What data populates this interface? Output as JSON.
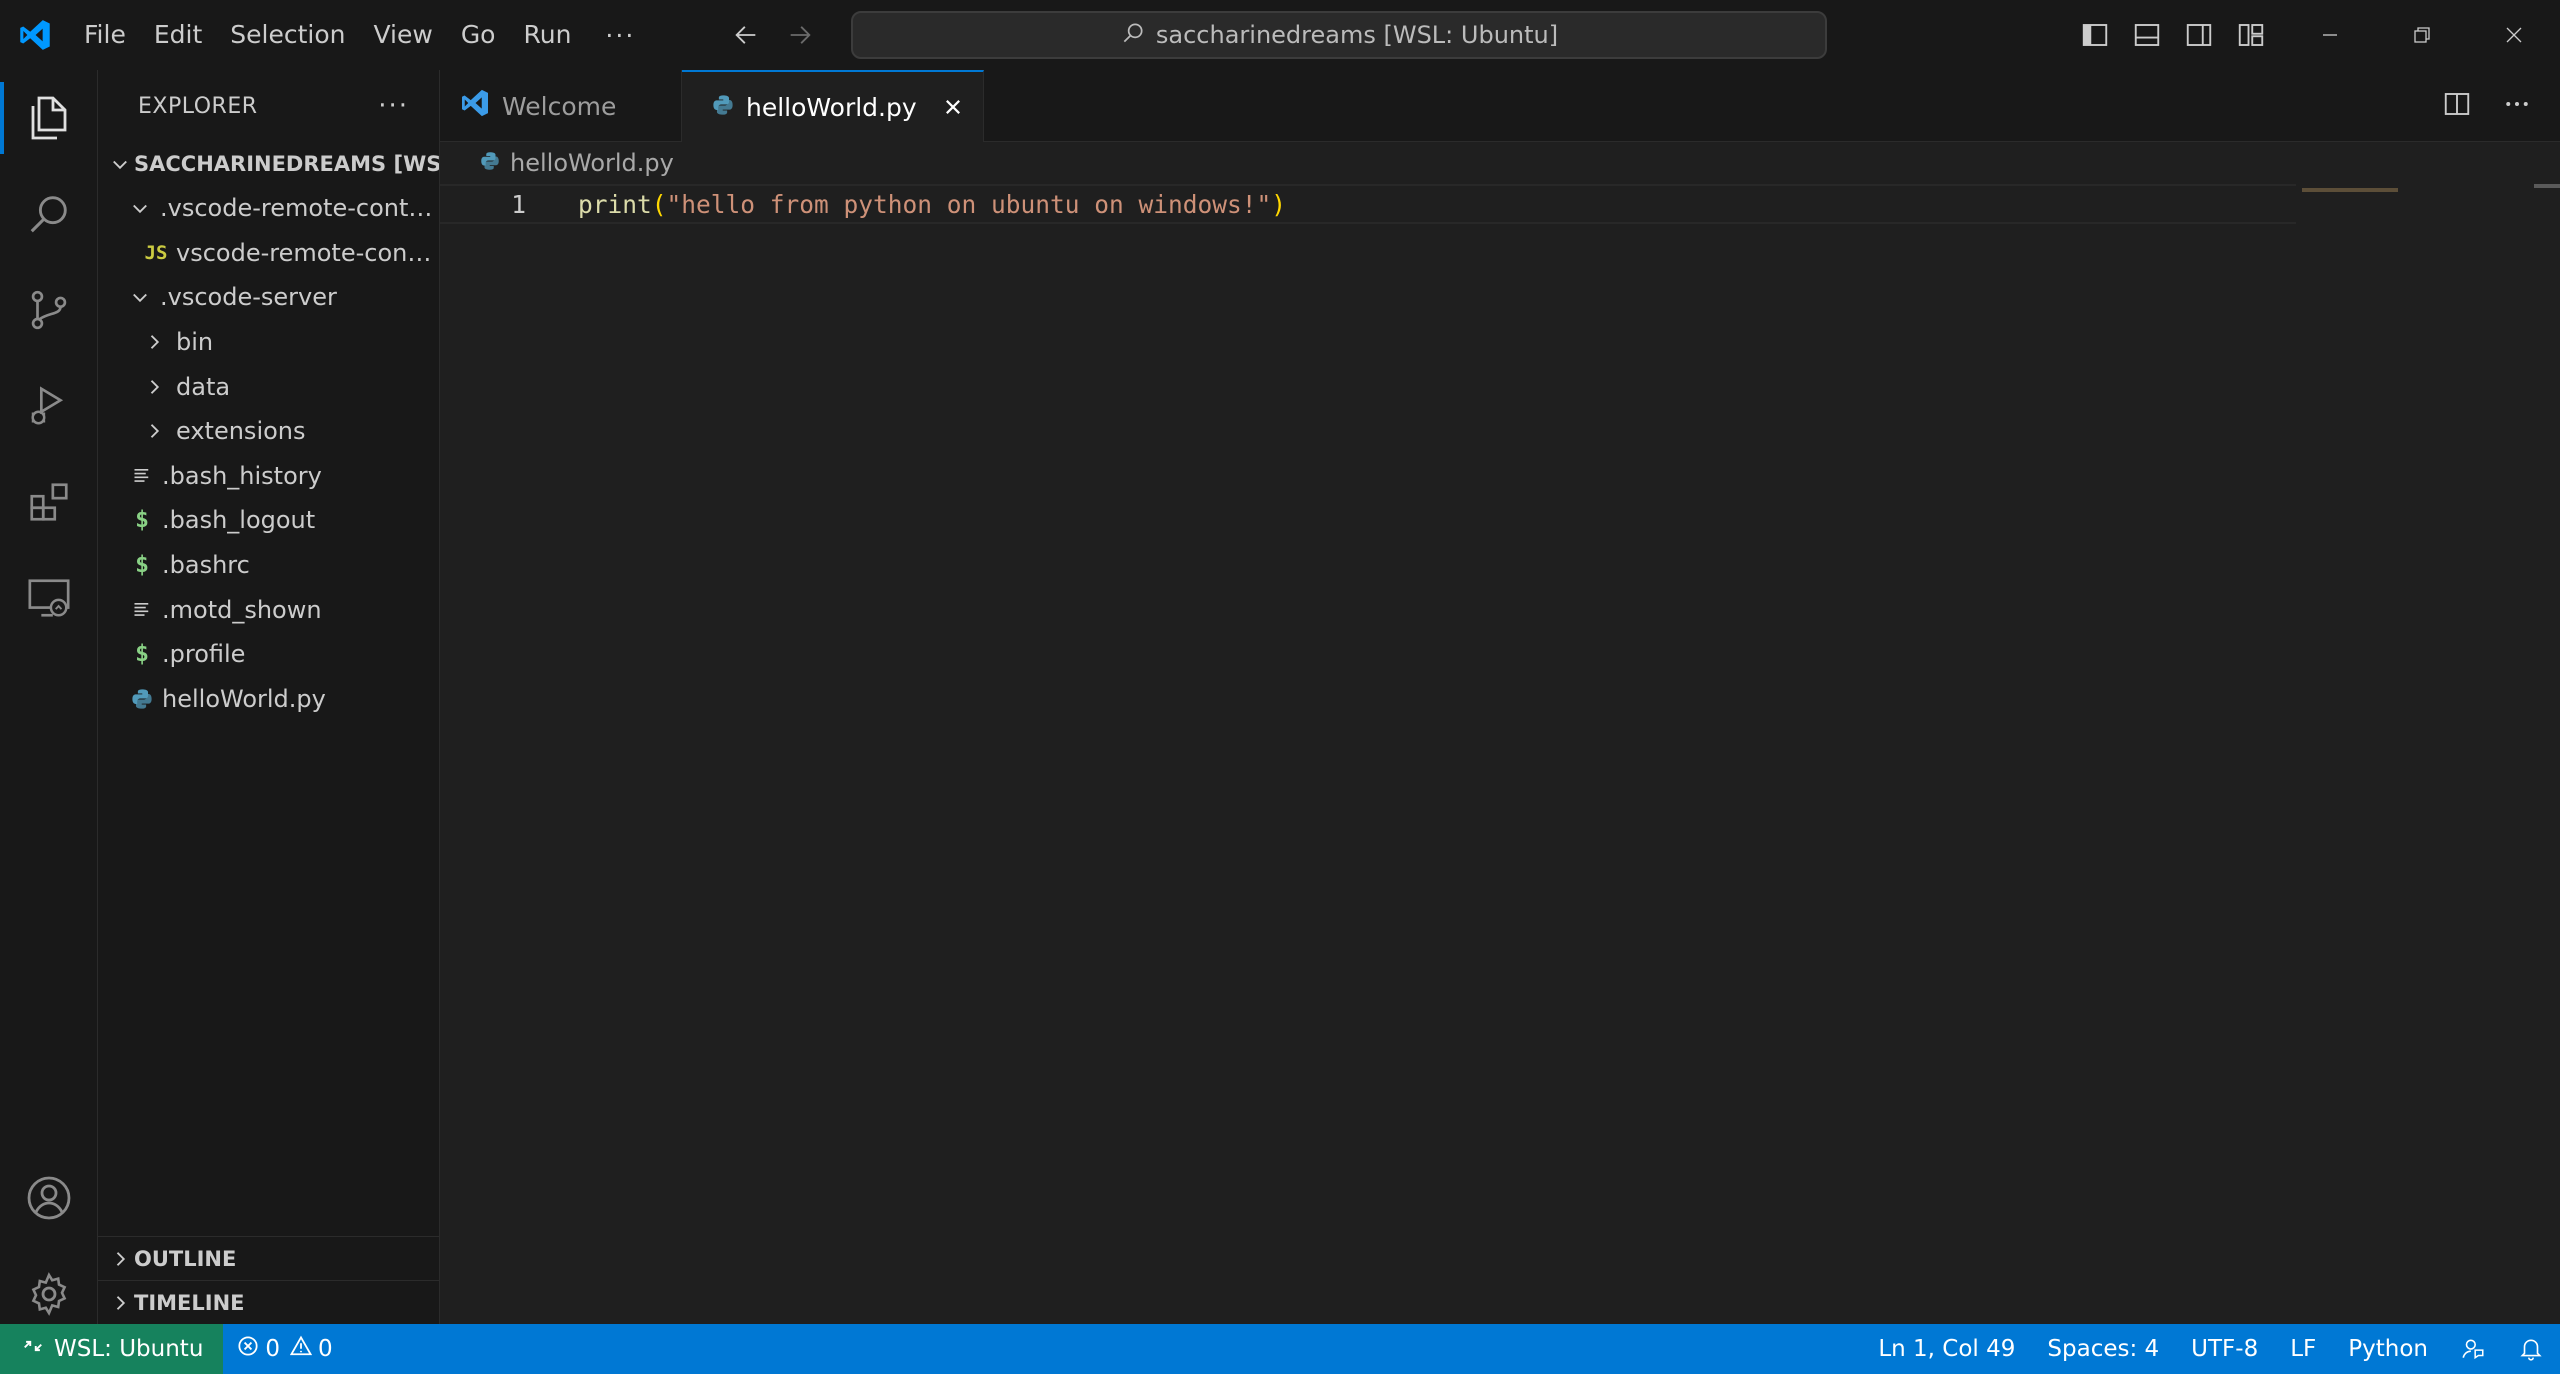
{
  "window": {
    "title": "saccharinedreams [WSL: Ubuntu]"
  },
  "menu": {
    "items": [
      "File",
      "Edit",
      "Selection",
      "View",
      "Go",
      "Run"
    ],
    "more": "···"
  },
  "sidebar": {
    "title": "EXPLORER",
    "more": "···",
    "root": "SACCHARINEDREAMS [WS...",
    "tree": [
      {
        "label": ".vscode-remote-conta...",
        "kind": "folder-open",
        "depth": 1
      },
      {
        "label": "vscode-remote-cont...",
        "kind": "js",
        "icon_text": "JS",
        "depth": 2
      },
      {
        "label": ".vscode-server",
        "kind": "folder-open",
        "depth": 1
      },
      {
        "label": "bin",
        "kind": "folder-closed",
        "depth": 2
      },
      {
        "label": "data",
        "kind": "folder-closed",
        "depth": 2
      },
      {
        "label": "extensions",
        "kind": "folder-closed",
        "depth": 2
      },
      {
        "label": ".bash_history",
        "kind": "text",
        "depth": 1
      },
      {
        "label": ".bash_logout",
        "kind": "shell",
        "icon_text": "$",
        "depth": 1
      },
      {
        "label": ".bashrc",
        "kind": "shell",
        "icon_text": "$",
        "depth": 1
      },
      {
        "label": ".motd_shown",
        "kind": "text",
        "depth": 1
      },
      {
        "label": ".profile",
        "kind": "shell",
        "icon_text": "$",
        "depth": 1
      },
      {
        "label": "helloWorld.py",
        "kind": "python",
        "depth": 1
      }
    ],
    "outline": "OUTLINE",
    "timeline": "TIMELINE"
  },
  "tabs": [
    {
      "label": "Welcome",
      "active": false,
      "icon": "vscode-icon"
    },
    {
      "label": "helloWorld.py",
      "active": true,
      "icon": "python-icon"
    }
  ],
  "breadcrumb": {
    "file": "helloWorld.py"
  },
  "editor": {
    "line_number": "1",
    "tokens": {
      "fn": "print",
      "open_paren": "(",
      "string": "\"hello from python on ubuntu on windows!\"",
      "close_paren": ")"
    }
  },
  "statusbar": {
    "remote": "WSL: Ubuntu",
    "errors": "0",
    "warnings": "0",
    "position": "Ln 1, Col 49",
    "spaces": "Spaces: 4",
    "encoding": "UTF-8",
    "eol": "LF",
    "language": "Python"
  },
  "colors": {
    "accent": "#0078d4",
    "remote": "#16825d",
    "shell_icon": "#89d185",
    "js_icon": "#cbcb41",
    "python_icon": "#519aba"
  }
}
